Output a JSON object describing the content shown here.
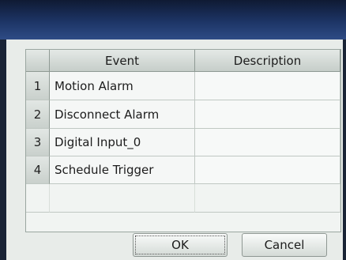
{
  "table": {
    "columns": [
      "Event",
      "Description"
    ],
    "rows": [
      {
        "index": "1",
        "event": "Motion Alarm",
        "description": ""
      },
      {
        "index": "2",
        "event": "Disconnect Alarm",
        "description": ""
      },
      {
        "index": "3",
        "event": "Digital Input_0",
        "description": ""
      },
      {
        "index": "4",
        "event": "Schedule Trigger",
        "description": ""
      }
    ]
  },
  "buttons": {
    "ok_label": "OK",
    "cancel_label": "Cancel"
  },
  "colors": {
    "titlebar": "#1d3566",
    "window_background": "#e8ece9",
    "grid_background": "#f1f4f2"
  }
}
